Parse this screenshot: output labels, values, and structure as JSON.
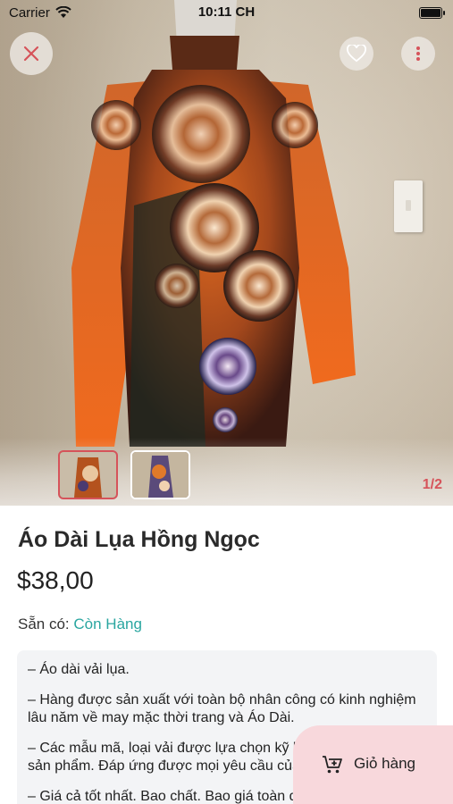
{
  "status_bar": {
    "carrier": "Carrier",
    "time": "10:11 CH"
  },
  "gallery": {
    "page_indicator": "1/2",
    "thumbnails": 2,
    "active_index": 0
  },
  "product": {
    "title": "Áo Dài Lụa Hồng Ngọc",
    "price": "$38,00",
    "stock_label": "Sẵn có:",
    "stock_value": "Còn Hàng",
    "description": [
      "– Áo dài vải lụa.",
      "– Hàng được sản xuất với toàn bộ nhân công có kinh nghiệm lâu năm về may mặc thời trang và Áo Dài.",
      "– Các mẫu mã, loại vải được lựa chọn kỹ lưỡng, chất lượng sản phẩm. Đáp ứng được mọi yêu cầu của khách hàng.",
      "– Giá cả tốt nhất. Bao chất. Bao giá toàn quốc."
    ]
  },
  "actions": {
    "cart_label": "Giỏ hàng"
  },
  "colors": {
    "accent": "#d6535a",
    "stock": "#2aa6a0",
    "cart_bg": "#f8d8dc"
  },
  "icons": {
    "close": "close-icon",
    "favorite": "heart-icon",
    "more": "more-vertical-icon",
    "cart": "cart-add-icon"
  }
}
